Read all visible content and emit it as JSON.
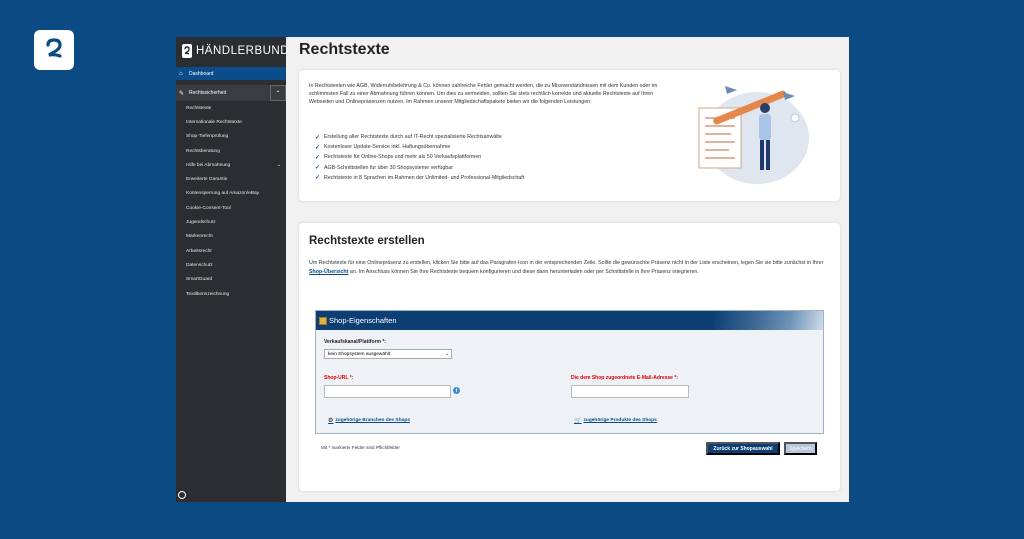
{
  "brand": {
    "name": "HÄNDLERBUND"
  },
  "sidebar": {
    "dashboard": "Dashboard",
    "group": "Rechtssicherheit",
    "items": [
      "Rechtstexte",
      "Internationale Rechtstexte",
      "Shop-Tiefenprüfung",
      "Rechtsberatung",
      "Hilfe bei Abmahnung",
      "Erweiterte Garantie",
      "Kontensperrung auf Amazon/eBay",
      "Cookie-Consent-Tool",
      "Jugendschutz",
      "Markenrecht",
      "Arbeitsrecht",
      "Datenschutz",
      "SmartGuard",
      "Textilkennzeichnung"
    ]
  },
  "main": {
    "title": "Rechtstexte",
    "intro": "In Rechtstexten wie AGB, Widerrufsbelehrung & Co. können zahlreiche Fehler gemacht werden, die zu Missverständnissen mit dem Kunden oder im schlimmsten Fall zu einer Abmahnung führen können. Um dies zu vermeiden, sollten Sie stets rechtlich korrekte und aktuelle Rechtstexte auf Ihren Webseiten und Onlinepräsenzen nutzen. Im Rahmen unserer Mitgliedschaftspakete bieten wir die folgenden Leistungen:",
    "features": [
      "Erstellung aller Rechtstexte durch auf IT-Recht spezialisierte Rechtsanwälte",
      "Kostenloser Update-Service inkl. Haftungsübernahme",
      "Rechtstexte für Online-Shops und mehr als 50 Verkaufsplattformen",
      "AGB-Schnittstellen für über 30 Shopsysteme verfügbar",
      "Rechtstexte in 8 Sprachen im Rahmen der Unlimited- und Professional-Mitgliedschaft"
    ],
    "create_title": "Rechtstexte erstellen",
    "create_desc_1": "Um Rechtstexte für eine Onlinepräsenz zu erstellen, klicken Sie bitte auf das Paragrafen-Icon in der entsprechenden Zeile. Sollte die gewünschte Präsenz nicht in der Liste erscheinen, legen Sie sie bitte zunächst in Ihrer ",
    "create_desc_link": "Shop-Übersicht",
    "create_desc_2": " an. Im Anschluss können Sie Ihre Rechtstexte bequem konfigurieren und diese dann herunterladen oder per Schnittstelle in Ihre Präsenz integrieren."
  },
  "panel": {
    "title": "Shop-Eigenschaften",
    "platform_label": "Verkaufskanal/Plattform *:",
    "platform_value": "kein Shopsystem ausgewählt",
    "url_label": "Shop-URL *:",
    "email_label": "Die dem Shop zugeordnete E-Mail-Adresse *:",
    "branches_link": "zugehörige Branchen des Shops",
    "products_link": "zugehörige Produkte des Shops"
  },
  "footer": {
    "mandatory_note": "Mit * markierte Felder sind Pflichtfelder",
    "back_button": "Zurück zur Shopauswahl",
    "save_button": "Speichern"
  }
}
